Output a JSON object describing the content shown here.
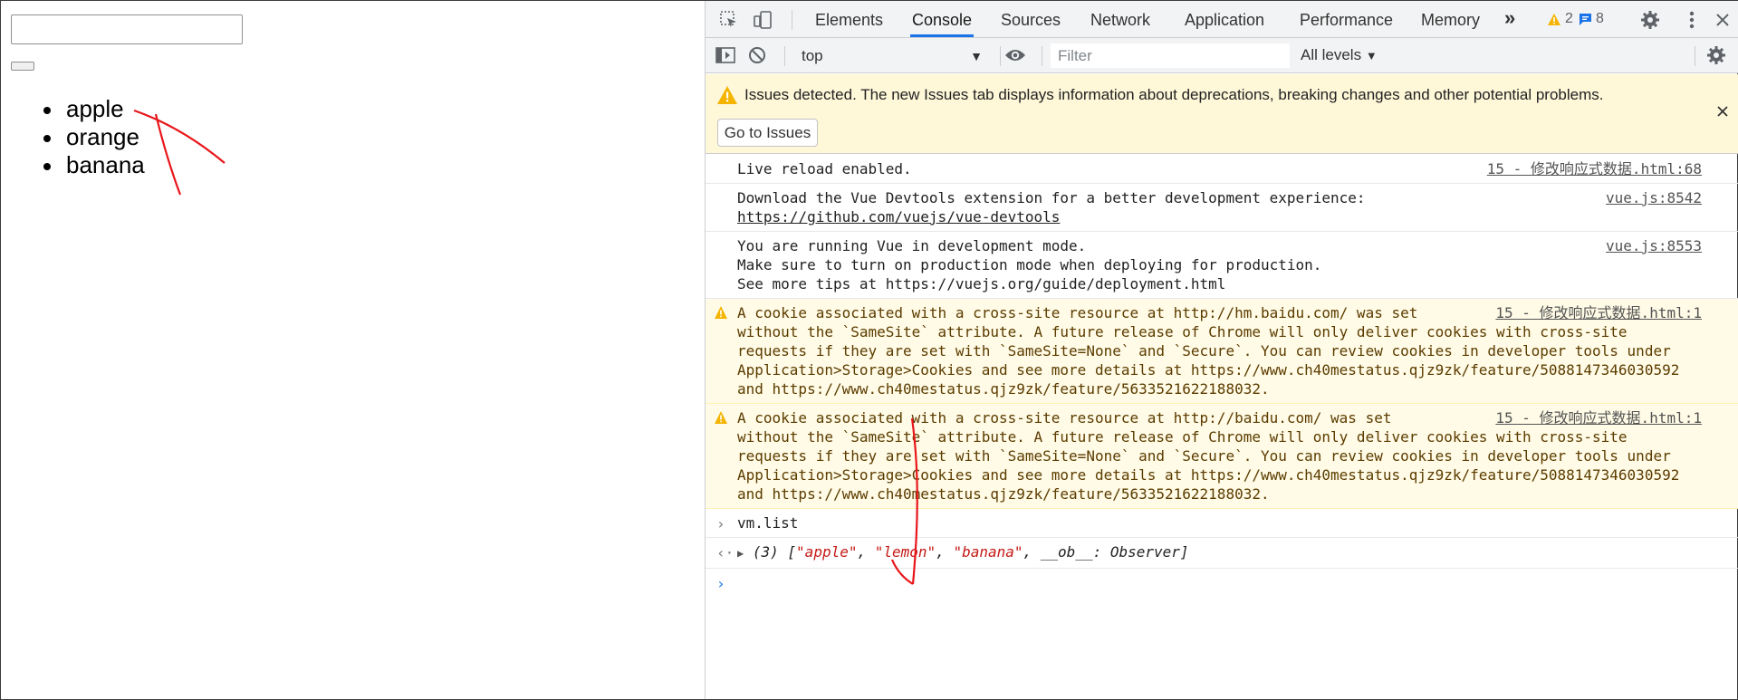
{
  "page": {
    "input_value": "",
    "button_label": "",
    "list": [
      "apple",
      "orange",
      "banana"
    ]
  },
  "devtools": {
    "tabs": [
      "Elements",
      "Console",
      "Sources",
      "Network",
      "Application",
      "Performance",
      "Memory"
    ],
    "active_tab": "Console",
    "more_tabs": "»",
    "warning_count": "2",
    "info_count": "8",
    "context": "top",
    "filter_placeholder": "Filter",
    "levels": "All levels",
    "issues_text": "Issues detected. The new Issues tab displays information about deprecations, breaking changes and other potential problems.",
    "goto_issues": "Go to Issues",
    "messages": [
      {
        "type": "log",
        "lines": [
          "Live reload enabled."
        ],
        "source": "15 - 修改响应式数据.html:68"
      },
      {
        "type": "log",
        "lines": [
          "Download the Vue Devtools extension for a better development experience:",
          "https://github.com/vuejs/vue-devtools"
        ],
        "source": "vue.js:8542"
      },
      {
        "type": "log",
        "lines": [
          "You are running Vue in development mode.",
          "Make sure to turn on production mode when deploying for production.",
          "See more tips at https://vuejs.org/guide/deployment.html"
        ],
        "source": "vue.js:8553"
      },
      {
        "type": "warn",
        "lines": [
          "A cookie associated with a cross-site resource at http://hm.baidu.com/ was set",
          "without the `SameSite` attribute. A future release of Chrome will only deliver cookies with cross-site",
          "requests if they are set with `SameSite=None` and `Secure`. You can review cookies in developer tools under",
          "Application>Storage>Cookies and see more details at https://www.ch40mestatus.qjz9zk/feature/5088147346030592",
          "and https://www.ch40mestatus.qjz9zk/feature/5633521622188032."
        ],
        "source": "15 - 修改响应式数据.html:1"
      },
      {
        "type": "warn",
        "lines": [
          "A cookie associated with a cross-site resource at http://baidu.com/ was set",
          "without the `SameSite` attribute. A future release of Chrome will only deliver cookies with cross-site",
          "requests if they are set with `SameSite=None` and `Secure`. You can review cookies in developer tools under",
          "Application>Storage>Cookies and see more details at https://www.ch40mestatus.qjz9zk/feature/5088147346030592",
          "and https://www.ch40mestatus.qjz9zk/feature/5633521622188032."
        ],
        "source": "15 - 修改响应式数据.html:1"
      }
    ],
    "input_echo": "vm.list",
    "result": {
      "count": "(3)",
      "items": [
        "\"apple\"",
        "\"lemon\"",
        "\"banana\""
      ],
      "ob": "__ob__: Observer"
    }
  },
  "colors": {
    "accent": "#1a73e8",
    "warning_bg": "#fffbe6",
    "banner_bg": "#fef7d8",
    "string_red": "#c41a16",
    "annotation_red": "#e8161b"
  }
}
